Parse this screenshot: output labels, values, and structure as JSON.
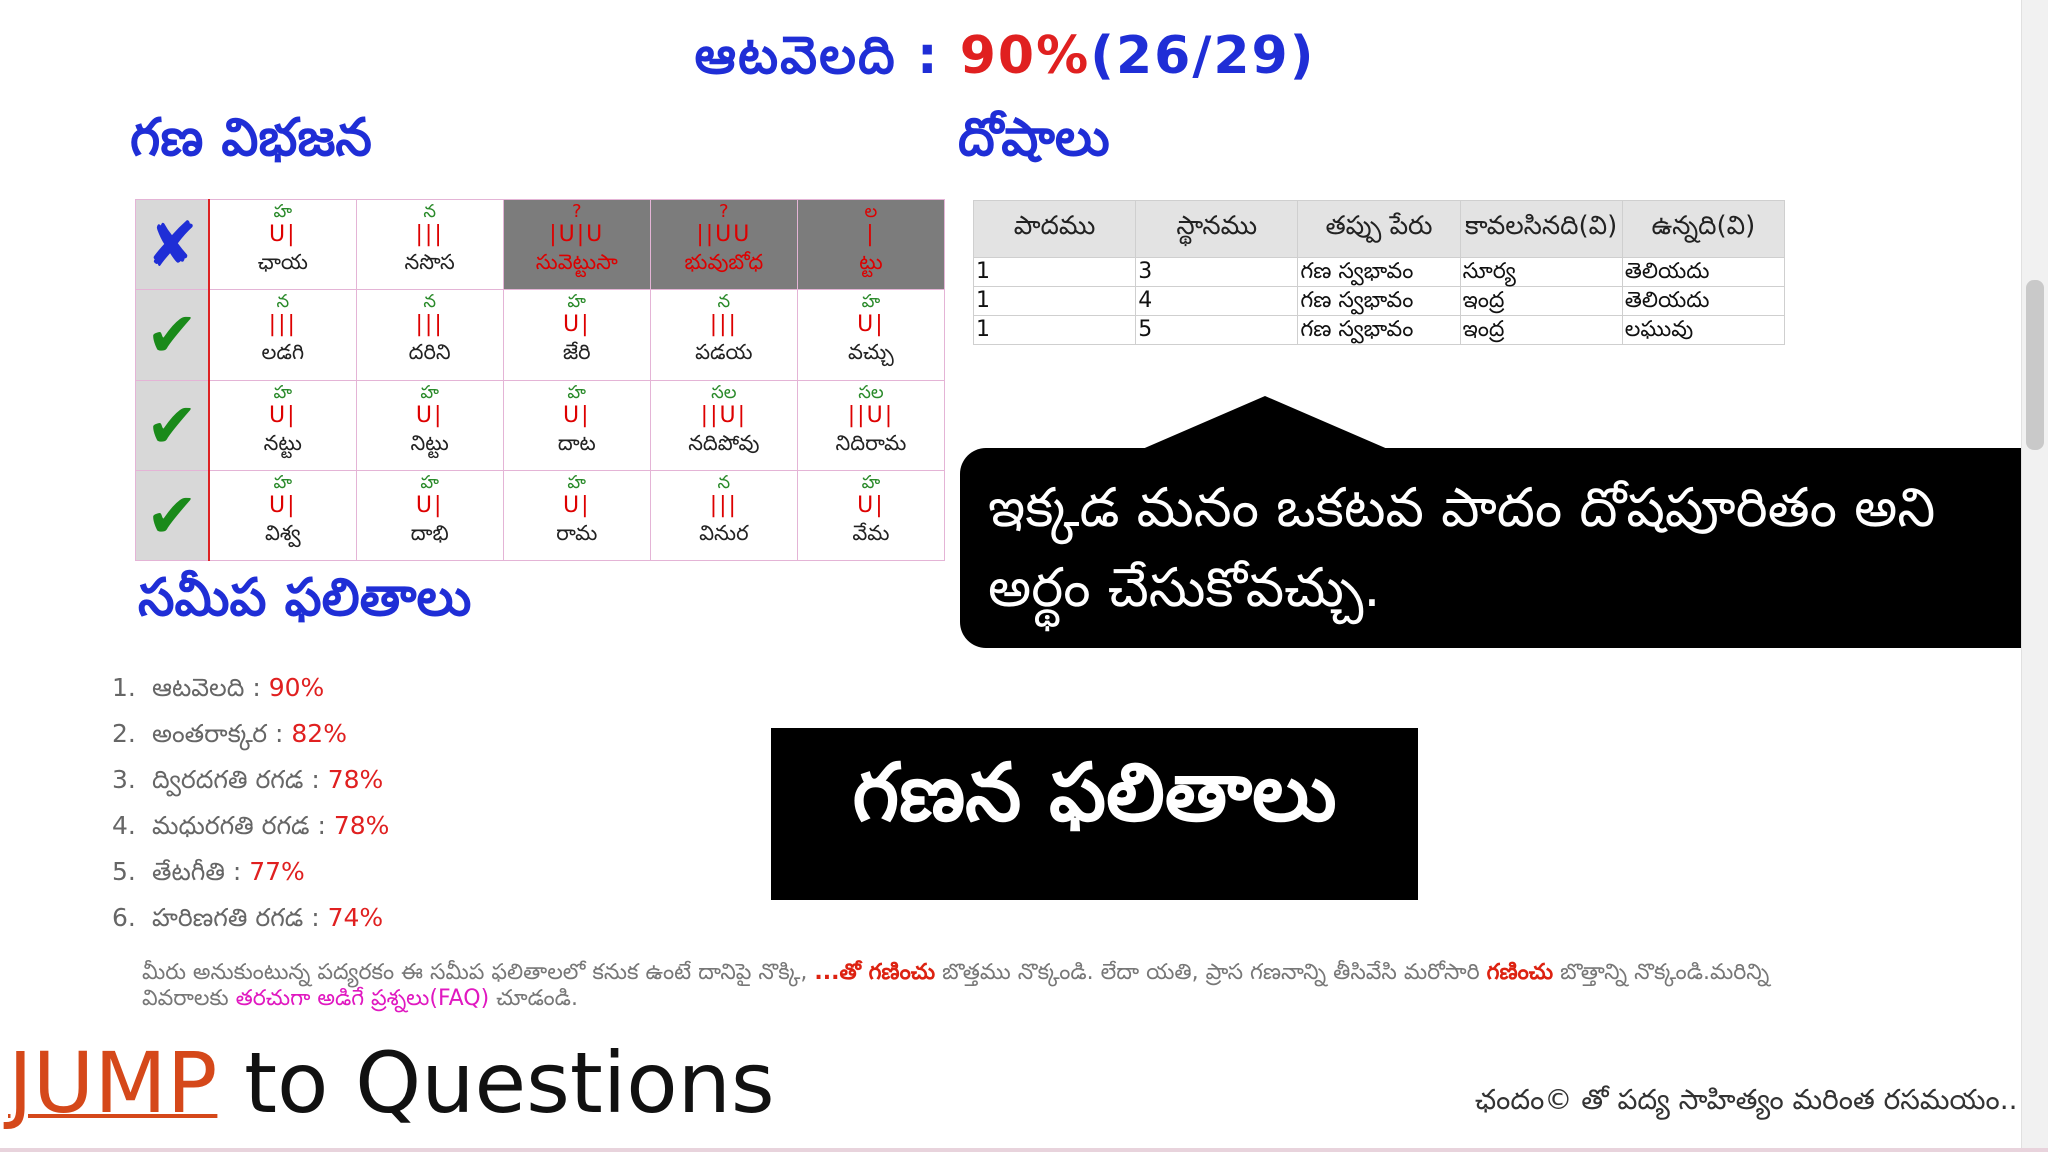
{
  "title": {
    "label": "ఆటవెలది : ",
    "percent": "90%",
    "fraction": "(26/29)"
  },
  "headings": {
    "gana": "గణ విభజన",
    "dosha": "దోషాలు",
    "near": "సమీప ఫలితాలు"
  },
  "gana_rows": [
    {
      "status": "✘",
      "cells": [
        {
          "name": "హ",
          "pattern": "U|",
          "syllables": "ఛాయ"
        },
        {
          "name": "న",
          "pattern": "|||",
          "syllables": "నసొస"
        },
        {
          "name": "?",
          "pattern": "|U|U",
          "syllables": "సువెట్టుసా",
          "error": true
        },
        {
          "name": "?",
          "pattern": "||UU",
          "syllables": "భువుబోధ",
          "error": true
        },
        {
          "name": "ల",
          "pattern": "|",
          "syllables": "ట్టు",
          "error": true
        }
      ]
    },
    {
      "status": "✔",
      "cells": [
        {
          "name": "న",
          "pattern": "|||",
          "syllables": "లడగి"
        },
        {
          "name": "న",
          "pattern": "|||",
          "syllables": "దరిని"
        },
        {
          "name": "హ",
          "pattern": "U|",
          "syllables": "జేరి"
        },
        {
          "name": "న",
          "pattern": "|||",
          "syllables": "పడయ"
        },
        {
          "name": "హ",
          "pattern": "U|",
          "syllables": "వచ్చు"
        }
      ]
    },
    {
      "status": "✔",
      "cells": [
        {
          "name": "హ",
          "pattern": "U|",
          "syllables": "నట్టు"
        },
        {
          "name": "హ",
          "pattern": "U|",
          "syllables": "నిట్టు"
        },
        {
          "name": "హ",
          "pattern": "U|",
          "syllables": "దాట"
        },
        {
          "name": "సల",
          "pattern": "||U|",
          "syllables": "నదిపోవు"
        },
        {
          "name": "సల",
          "pattern": "||U|",
          "syllables": "నిదిరామ"
        }
      ]
    },
    {
      "status": "✔",
      "cells": [
        {
          "name": "హ",
          "pattern": "U|",
          "syllables": "విశ్వ"
        },
        {
          "name": "హ",
          "pattern": "U|",
          "syllables": "దాభి"
        },
        {
          "name": "హ",
          "pattern": "U|",
          "syllables": "రామ"
        },
        {
          "name": "న",
          "pattern": "|||",
          "syllables": "వినుర"
        },
        {
          "name": "హ",
          "pattern": "U|",
          "syllables": "వేమ"
        }
      ]
    }
  ],
  "dosha_table": {
    "headers": [
      "పాదము",
      "స్థానము",
      "తప్పు పేరు",
      "కావలసినది(వి)",
      "ఉన్నది(వి)"
    ],
    "rows": [
      [
        "1",
        "3",
        "గణ స్వభావం",
        "సూర్య",
        "తెలియదు"
      ],
      [
        "1",
        "4",
        "గణ స్వభావం",
        "ఇంద్ర",
        "తెలియదు"
      ],
      [
        "1",
        "5",
        "గణ స్వభావం",
        "ఇంద్ర",
        "లఘువు"
      ]
    ]
  },
  "callout": "ఇక్కడ మనం ఒకటవ పాదం దోషపూరితం అని అర్థం చేసుకోవచ్చు.",
  "near_results": [
    {
      "num": "1.",
      "name": "ఆటవెలది : ",
      "value": "90%"
    },
    {
      "num": "2.",
      "name": "అంతరాక్కర : ",
      "value": "82%"
    },
    {
      "num": "3.",
      "name": "ద్విరదగతి రగడ : ",
      "value": "78%"
    },
    {
      "num": "4.",
      "name": "మధురగతి రగడ : ",
      "value": "78%"
    },
    {
      "num": "5.",
      "name": "తేటగీతి : ",
      "value": "77%"
    },
    {
      "num": "6.",
      "name": "హరిణగతి రగడ : ",
      "value": "74%"
    }
  ],
  "big_label": "గణన ఫలితాలు",
  "info": {
    "part1": "మీరు అనుకుంటున్న పద్యరకం ఈ సమీప ఫలితాలలో కనుక ఉంటే దానిపై నొక్కి, ",
    "red1": "...తో గణించు",
    "part2": " బొత్తము నొక్కండి. లేదా యతి, ప్రాస గణనాన్ని తీసివేసి మరోసారి ",
    "red2": "గణించు",
    "part3": " బొత్తాన్ని నొక్కండి.మరిన్ని వివరాలకు ",
    "link": "తరచుగా అడిగే ప్రశ్నలు(FAQ)",
    "part4": " చూడండి."
  },
  "jump": {
    "jump": "JUMP",
    "rest": " to Questions"
  },
  "footer": "ఛందం© తో పద్య సాహిత్యం మరింత రసమయం..!!",
  "colors": {
    "heading_blue": "#1f2ed6",
    "value_red": "#e02020",
    "tick_green": "#1a8a1a",
    "link_pink": "#e018c0",
    "jump_orange": "#d5481a"
  }
}
